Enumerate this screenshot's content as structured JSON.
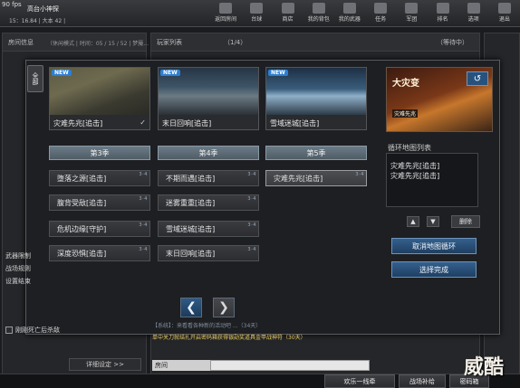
{
  "topbar": {
    "fps": "90 fps",
    "player_name": "高台小神探",
    "player_rank": "15：16.84 | 大本 42 | ",
    "nav": [
      {
        "label": "返回房间",
        "icon": "room-icon"
      },
      {
        "label": "台球",
        "icon": "billiards-icon"
      },
      {
        "label": "商店",
        "icon": "shop-icon"
      },
      {
        "label": "我的背包",
        "icon": "bag-icon"
      },
      {
        "label": "我的武器",
        "icon": "weapon-icon"
      },
      {
        "label": "任务",
        "icon": "task-icon"
      },
      {
        "label": "军团",
        "icon": "legion-icon"
      },
      {
        "label": "排名",
        "icon": "rank-icon"
      },
      {
        "label": "选项",
        "icon": "options-icon"
      },
      {
        "label": "退出",
        "icon": "exit-icon"
      }
    ]
  },
  "background": {
    "room_header": "房间信息",
    "room_subtitle": "（休闲模式 | 时间：05 / 15 / 52 | 梦魇...",
    "players_header": "玩家列表",
    "players_count": "（1/4）",
    "players_status": "（等待中）",
    "left_labels": [
      "武器限制",
      "战场规则",
      "设置结束"
    ],
    "option_label": "刚刚死亡后杀敌",
    "detail_button": "详细设定 >>",
    "chat_line_1": "【系统】：来看看各种新的活动吧 ...（34天）",
    "chat_line_2": "单中关刀就结扎开启密码箱获得银勋奖道具金甲战神符（30天）",
    "chat_channel": "房间",
    "chat_input_value": ""
  },
  "modal": {
    "tab_label": "全部",
    "featured_maps": [
      {
        "name": "灾难先兆[追击]",
        "new": "NEW",
        "checked": true
      },
      {
        "name": "末日回响[追击]",
        "new": "NEW",
        "checked": false
      },
      {
        "name": "雪域迷城[追击]",
        "new": "NEW",
        "checked": false
      }
    ],
    "seasons": [
      {
        "title": "第3季",
        "maps": [
          "堕落之源[追击]",
          "腹背受敌[追击]",
          "危机边缘[守护]",
          "深度恐惧[追击]"
        ]
      },
      {
        "title": "第4季",
        "maps": [
          "不期而遇[追击]",
          "迷雾重重[追击]",
          "雪域迷城[追击]",
          "末日回响[追击]"
        ]
      },
      {
        "title": "第5季",
        "maps": [
          "灾难先兆[追击]"
        ]
      }
    ],
    "player_marker": "3 · 4",
    "prev_arrow": "❮",
    "next_arrow": "❯",
    "featured_title": "大灾变",
    "featured_mode": "灾难先兆",
    "refresh_icon": "↺",
    "cycle_label": "循环地图列表",
    "cycle_list": [
      "灾难先兆[追击]",
      "灾难先兆[追击]"
    ],
    "up_arrow": "▲",
    "down_arrow": "▼",
    "delete_label": "删除",
    "cancel_cycle_label": "取消地图循环",
    "confirm_label": "选择完成"
  },
  "bottom": {
    "back_lobby": "欢乐一线牵",
    "war_supply": "战场补给",
    "settings": "密码箱"
  },
  "watermark": "威酷"
}
